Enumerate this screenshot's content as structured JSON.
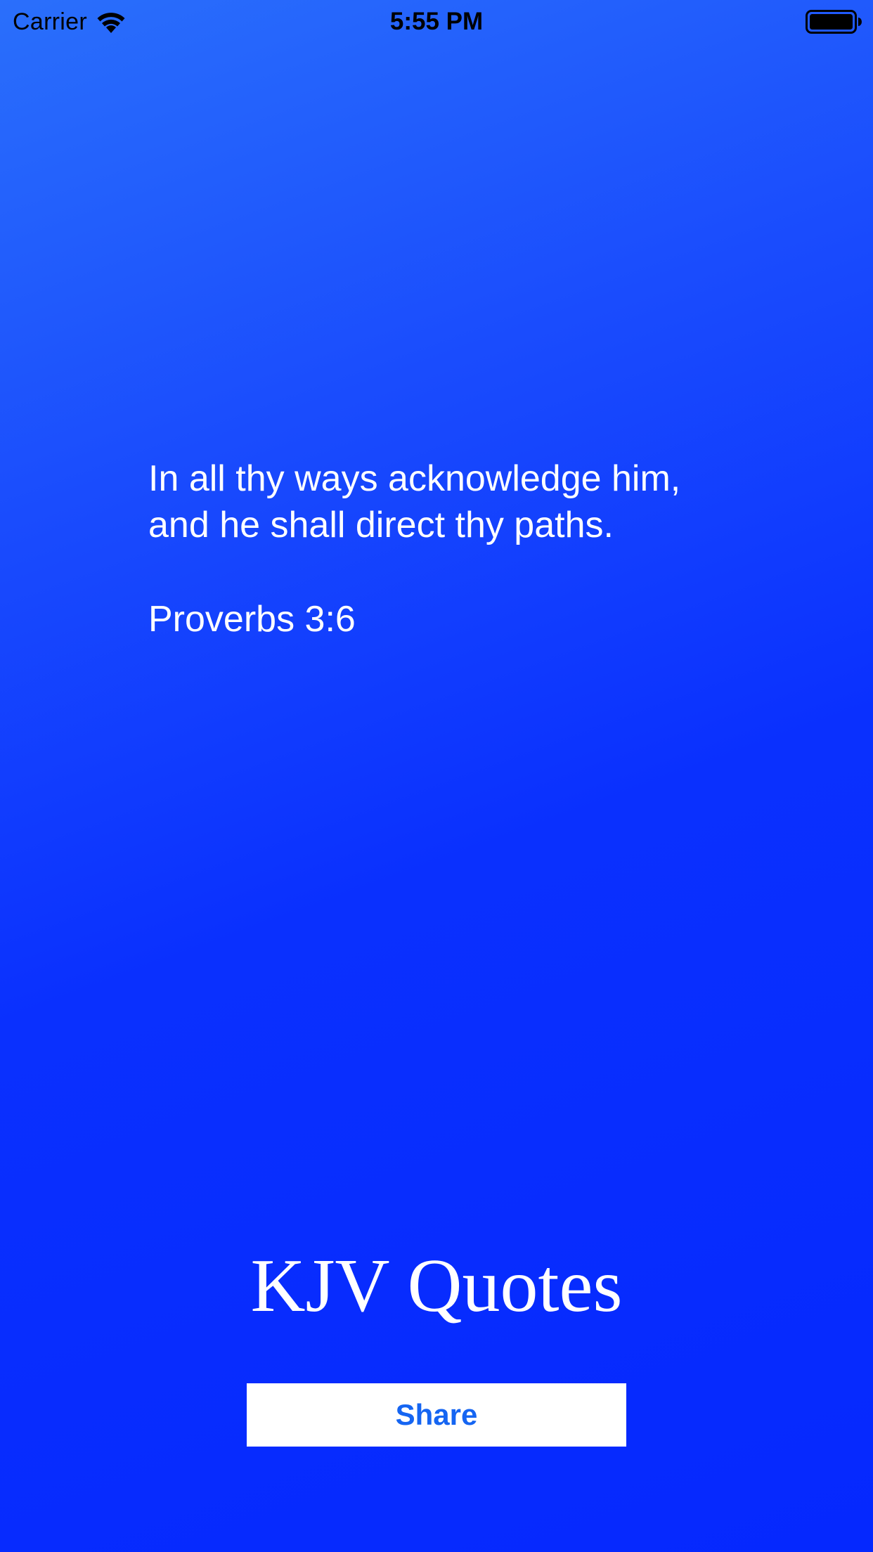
{
  "status_bar": {
    "carrier": "Carrier",
    "time": "5:55 PM",
    "icons": [
      "wifi-icon",
      "battery-icon"
    ]
  },
  "quote": {
    "text": "In all thy ways acknowledge him,\nand he shall direct thy paths.",
    "reference": "Proverbs 3:6"
  },
  "app": {
    "title": "KJV Quotes"
  },
  "actions": {
    "share_label": "Share"
  },
  "colors": {
    "background_top": "#2a6ffb",
    "background_bottom": "#0528fe",
    "text": "#ffffff",
    "button_background": "#ffffff",
    "button_text": "#1565f2"
  }
}
